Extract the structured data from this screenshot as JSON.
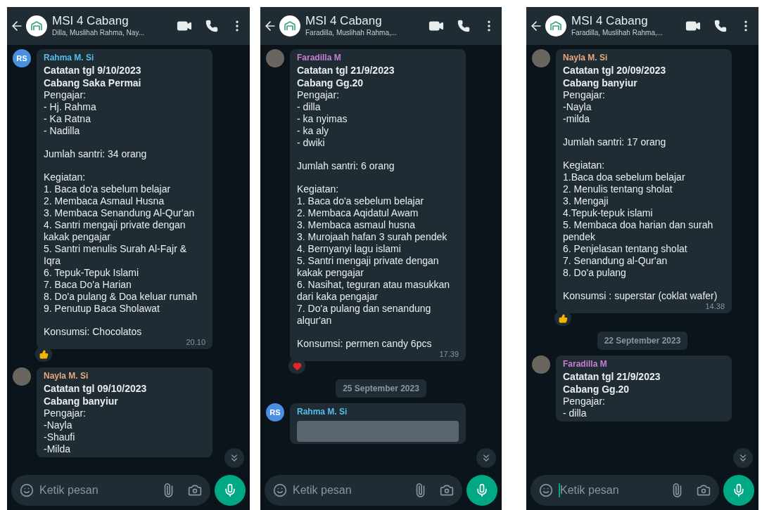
{
  "panels": [
    {
      "header": {
        "title": "MSI 4 Cabang",
        "subtitle": "Dilla, Muslihah Rahma, Nay..."
      },
      "items": [
        {
          "kind": "message",
          "sender": "Rahma M. Si",
          "color": "#53bdeb",
          "avatar": {
            "kind": "initials",
            "text": "RS"
          },
          "headings": [
            "Catatan tgl 9/10/2023",
            "Cabang Saka Permai"
          ],
          "blocks": [
            [
              "Pengajar:",
              "- Hj. Rahma",
              "- Ka Ratna",
              "- Nadilla"
            ],
            [
              "Jumlah santri: 34 orang"
            ],
            [
              "Kegiatan:",
              "1. Baca do'a sebelum belajar",
              "2. Membaca Asmaul Husna",
              "3. Membaca Senandung Al-Qur'an",
              "4. Santri mengaji private dengan kakak pengajar",
              "5. Santri menulis Surah Al-Fajr & Iqra",
              "6. Tepuk-Tepuk Islami",
              "7. Baca Do'a Harian",
              "8. Do'a pulang & Doa keluar rumah",
              "9. Penutup Baca Sholawat"
            ],
            [
              "Konsumsi: Chocolatos"
            ]
          ],
          "time": "20.10",
          "reaction": {
            "kind": "thumbs-up"
          }
        },
        {
          "kind": "message",
          "sender": "Nayla M. Si",
          "color": "#e8a87c",
          "avatar": {
            "kind": "photo"
          },
          "headings": [
            "Catatan tgl 09/10/2023",
            "Cabang banyiur"
          ],
          "blocks": [
            [
              "Pengajar:",
              "-Nayla",
              "-Shaufi",
              "-Milda"
            ]
          ]
        }
      ],
      "input": {
        "placeholder": "Ketik pesan",
        "focused": false
      }
    },
    {
      "header": {
        "title": "MSI 4 Cabang",
        "subtitle": "Faradilla, Muslihah Rahma,..."
      },
      "items": [
        {
          "kind": "message",
          "sender": "Faradilla M",
          "color": "#c77fd4",
          "avatar": {
            "kind": "photo"
          },
          "headings": [
            "Catatan tgl 21/9/2023",
            "Cabang Gg.20"
          ],
          "blocks": [
            [
              "Pengajar:",
              "- dilla",
              "- ka nyimas",
              "- ka aly",
              "- dwiki"
            ],
            [
              "Jumlah santri: 6 orang"
            ],
            [
              "Kegiatan:",
              "1. Baca do'a sebelum belajar",
              "2. Membaca Aqidatul Awam",
              "3. Membaca asmaul husna",
              "3. Murojaah hafan 3 surah pendek",
              "4. Bernyanyi lagu islami",
              "5. Santri mengaji private dengan kakak pengajar",
              "6. Nasihat, teguran atau masukkan dari kaka pengajar",
              "7. Do'a pulang dan senandung alqur'an"
            ],
            [
              "Konsumsi: permen candy 6pcs"
            ]
          ],
          "time": "17.39",
          "reaction": {
            "kind": "heart"
          }
        },
        {
          "kind": "date",
          "text": "25 September 2023"
        },
        {
          "kind": "message",
          "sender": "Rahma M. Si",
          "color": "#53bdeb",
          "avatar": {
            "kind": "initials",
            "text": "RS"
          },
          "image": true
        }
      ],
      "input": {
        "placeholder": "Ketik pesan",
        "focused": false
      }
    },
    {
      "header": {
        "title": "MSI 4 Cabang",
        "subtitle": "Faradilla, Muslihah Rahma,..."
      },
      "items": [
        {
          "kind": "message",
          "sender": "Nayla M. Si",
          "color": "#e8a87c",
          "avatar": {
            "kind": "photo"
          },
          "headings": [
            "Catatan tgl 20/09/2023",
            "Cabang banyiur"
          ],
          "blocks": [
            [
              "Pengajar:",
              "-Nayla",
              "-milda"
            ],
            [
              "Jumlah santri: 17 orang"
            ],
            [
              "Kegiatan:",
              "1.Baca doa sebelum belajar",
              "2. Menulis tentang sholat",
              "3. Mengaji",
              "4.Tepuk-tepuk islami",
              "5. Membaca doa harian dan surah pendek",
              "6. Penjelasan tentang sholat",
              "7. Senandung al-Qur'an",
              "8. Do'a pulang"
            ],
            [
              "Konsumsi : superstar (coklat wafer)"
            ]
          ],
          "time": "14.38",
          "reaction": {
            "kind": "thumbs-up"
          }
        },
        {
          "kind": "date",
          "text": "22 September 2023"
        },
        {
          "kind": "message",
          "sender": "Faradilla M",
          "color": "#c77fd4",
          "avatar": {
            "kind": "photo"
          },
          "headings": [
            "Catatan tgl 21/9/2023",
            "Cabang Gg.20"
          ],
          "blocks": [
            [
              "Pengajar:",
              "- dilla"
            ]
          ]
        }
      ],
      "input": {
        "placeholder": "Ketik pesan",
        "focused": true
      }
    }
  ]
}
